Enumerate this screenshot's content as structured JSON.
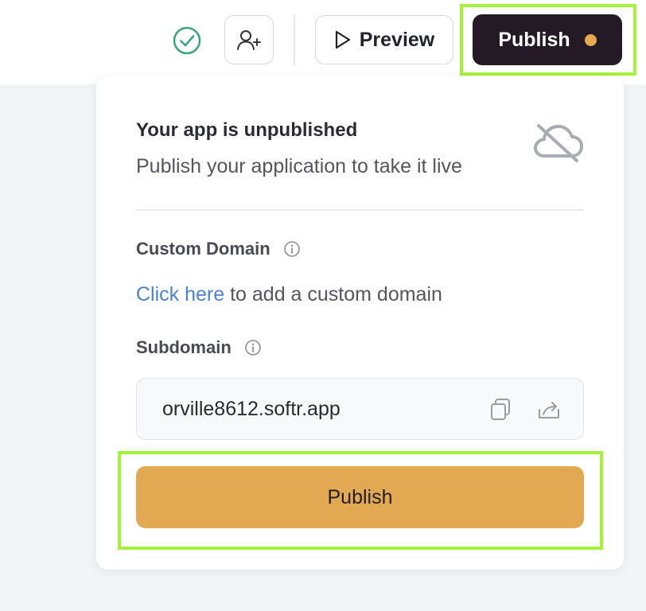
{
  "topbar": {
    "preview_label": "Preview",
    "publish_label": "Publish",
    "status_icon": "check-circle-icon",
    "invite_icon": "user-plus-icon",
    "status_dot_color": "#e8a94c"
  },
  "panel": {
    "title": "Your app is unpublished",
    "subtitle": "Publish your application to take it live",
    "status_icon": "cloud-off-icon",
    "custom_domain": {
      "label": "Custom Domain",
      "link_text": "Click here",
      "rest_text": " to add a custom domain"
    },
    "subdomain": {
      "label": "Subdomain",
      "value": "orville8612.softr.app"
    },
    "publish_button": "Publish"
  },
  "colors": {
    "accent": "#e3a952",
    "dark_button": "#231a26",
    "link": "#4a83d4",
    "highlight": "#a6f13c",
    "success": "#3aa57a"
  }
}
